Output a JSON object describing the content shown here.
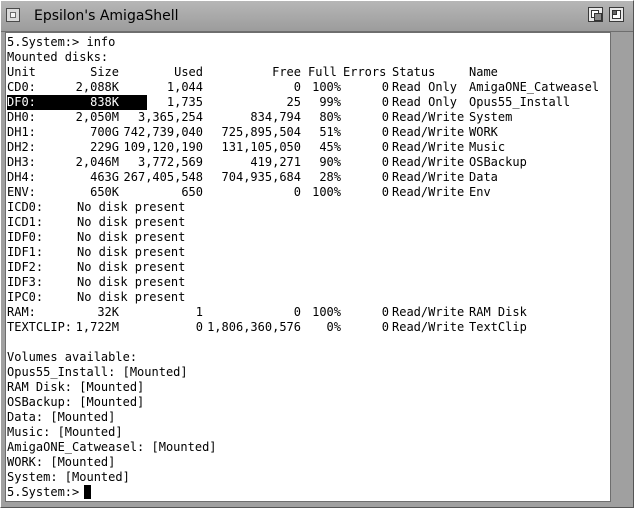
{
  "window": {
    "title": "Epsilon's AmigaShell"
  },
  "shell": {
    "command_line": "5.System:> info",
    "mounted_header": "Mounted disks:",
    "columns": [
      "Unit",
      "Size",
      "Used",
      "Free",
      "Full",
      "Errors",
      "Status",
      "Name"
    ],
    "rows": [
      {
        "unit": "CD0:",
        "size": "2,088K",
        "used": "1,044",
        "free": "0",
        "full": "100%",
        "errors": "0",
        "status": "Read Only",
        "name": "AmigaONE_Catweasel"
      },
      {
        "unit": "DF0:",
        "size": "838K",
        "used": "1,735",
        "free": "25",
        "full": "99%",
        "errors": "0",
        "status": "Read Only",
        "name": "Opus55_Install"
      },
      {
        "unit": "DH0:",
        "size": "2,050M",
        "used": "3,365,254",
        "free": "834,794",
        "full": "80%",
        "errors": "0",
        "status": "Read/Write",
        "name": "System"
      },
      {
        "unit": "DH1:",
        "size": "700G",
        "used": "742,739,040",
        "free": "725,895,504",
        "full": "51%",
        "errors": "0",
        "status": "Read/Write",
        "name": "WORK"
      },
      {
        "unit": "DH2:",
        "size": "229G",
        "used": "109,120,190",
        "free": "131,105,050",
        "full": "45%",
        "errors": "0",
        "status": "Read/Write",
        "name": "Music"
      },
      {
        "unit": "DH3:",
        "size": "2,046M",
        "used": "3,772,569",
        "free": "419,271",
        "full": "90%",
        "errors": "0",
        "status": "Read/Write",
        "name": "OSBackup"
      },
      {
        "unit": "DH4:",
        "size": "463G",
        "used": "267,405,548",
        "free": "704,935,684",
        "full": "28%",
        "errors": "0",
        "status": "Read/Write",
        "name": "Data"
      },
      {
        "unit": "ENV:",
        "size": "650K",
        "used": "650",
        "free": "0",
        "full": "100%",
        "errors": "0",
        "status": "Read/Write",
        "name": "Env"
      },
      {
        "unit": "ICD0:",
        "nodisk": "No disk present"
      },
      {
        "unit": "ICD1:",
        "nodisk": "No disk present"
      },
      {
        "unit": "IDF0:",
        "nodisk": "No disk present"
      },
      {
        "unit": "IDF1:",
        "nodisk": "No disk present"
      },
      {
        "unit": "IDF2:",
        "nodisk": "No disk present"
      },
      {
        "unit": "IDF3:",
        "nodisk": "No disk present"
      },
      {
        "unit": "IPC0:",
        "nodisk": "No disk present"
      },
      {
        "unit": "RAM:",
        "size": "32K",
        "used": "1",
        "free": "0",
        "full": "100%",
        "errors": "0",
        "status": "Read/Write",
        "name": "RAM Disk"
      },
      {
        "unit": "TEXTCLIP:",
        "size": "1,722M",
        "used": "0",
        "free": "1,806,360,576",
        "full": "0%",
        "errors": "0",
        "status": "Read/Write",
        "name": "TextClip"
      }
    ],
    "volumes_header": "Volumes available:",
    "volumes": [
      "Opus55_Install: [Mounted]",
      "RAM Disk: [Mounted]",
      "OSBackup: [Mounted]",
      "Data: [Mounted]",
      "Music: [Mounted]",
      "AmigaONE_Catweasel: [Mounted]",
      "WORK: [Mounted]",
      "System: [Mounted]"
    ],
    "prompt": "5.System:> "
  },
  "icons": {
    "close": "close-gadget-icon",
    "depth": "depth-gadget-icon",
    "zoom": "zoom-gadget-icon"
  }
}
